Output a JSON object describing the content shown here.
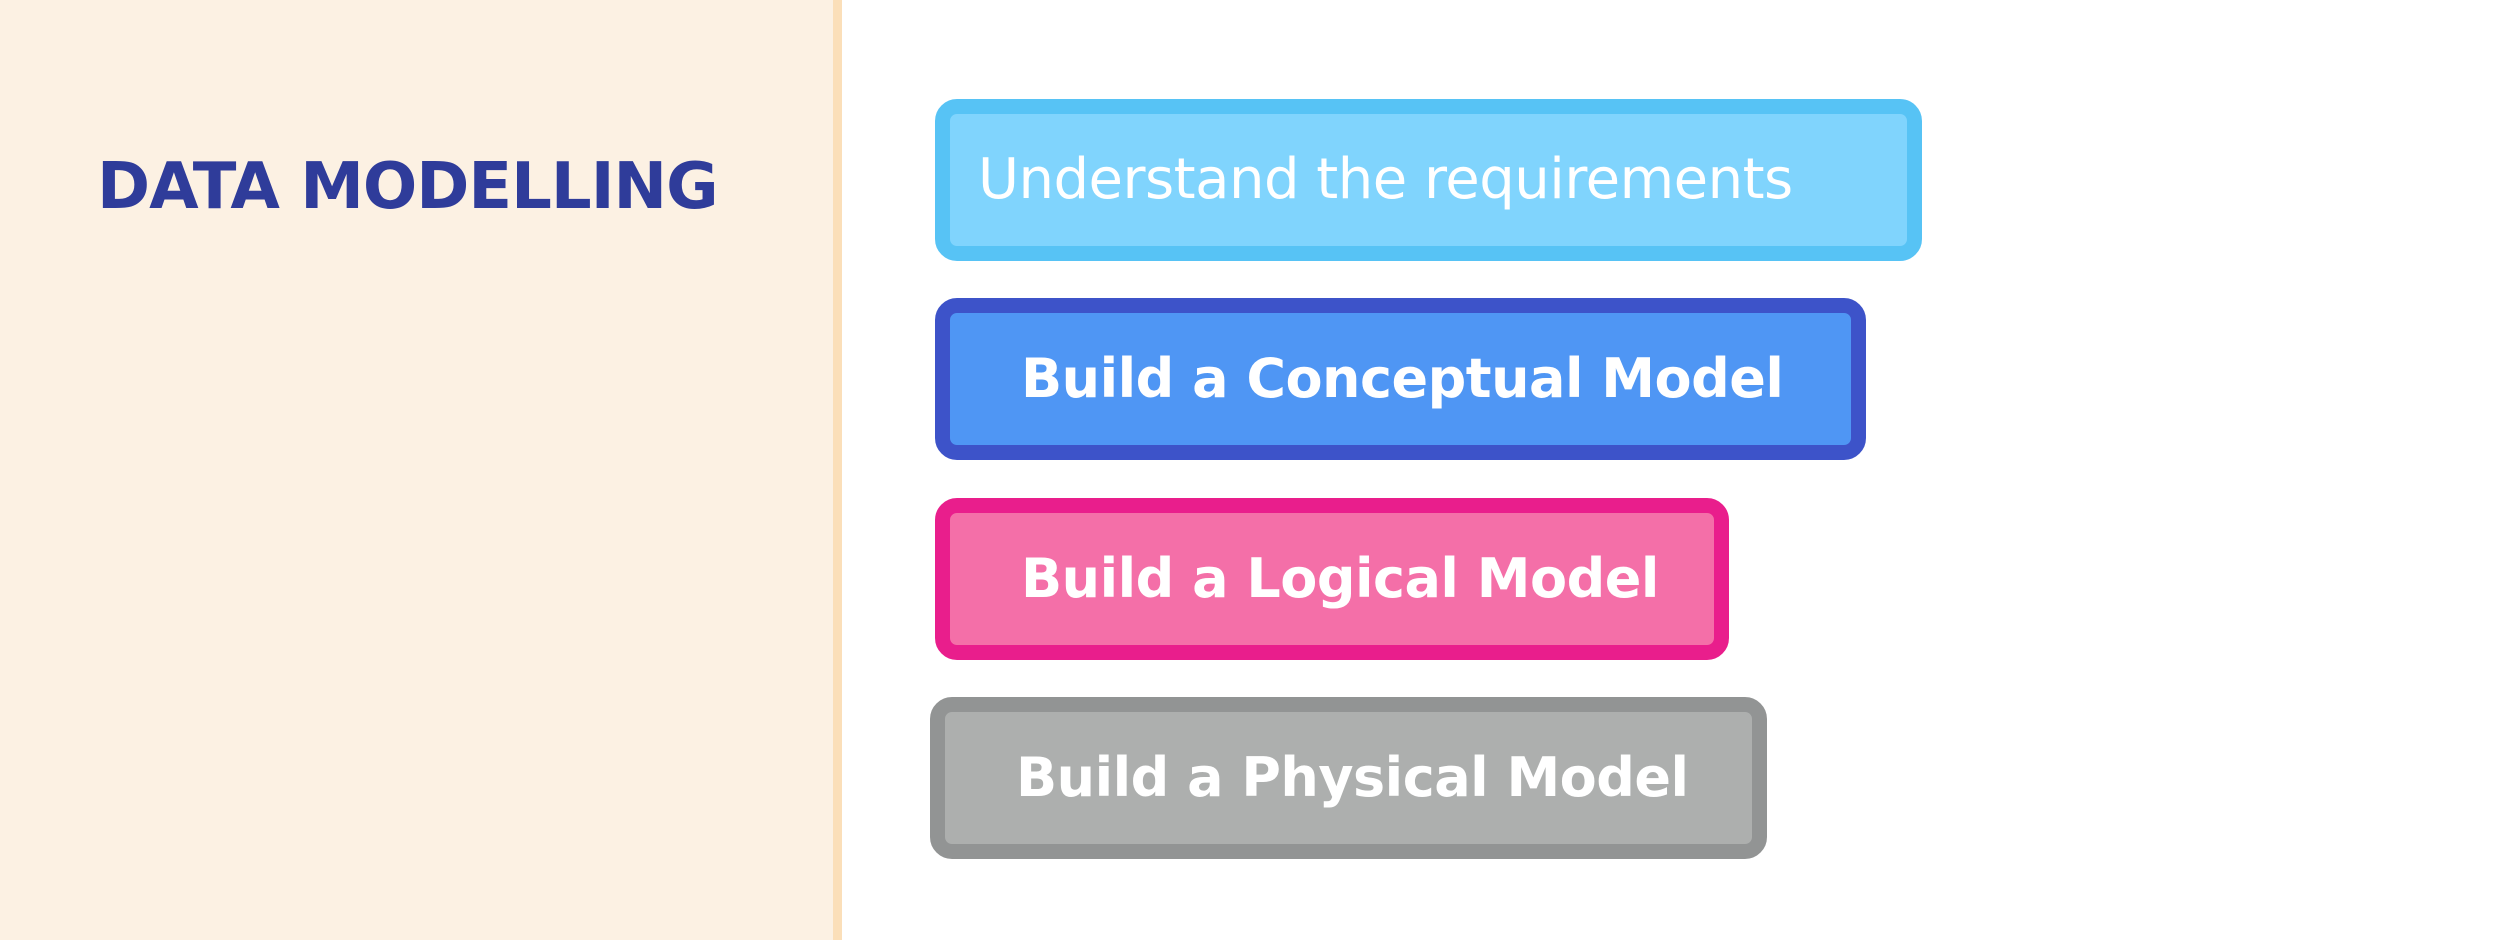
{
  "title": "DATA MODELLING",
  "steps": [
    {
      "label": "Understand the requirements",
      "fill": "#80d4fd",
      "border": "#57c3f5"
    },
    {
      "label": "Build a Conceptual Model",
      "fill": "#4f96f4",
      "border": "#3d53c9"
    },
    {
      "label": "Build a Logical Model",
      "fill": "#f46fa8",
      "border": "#e91e8c"
    },
    {
      "label": "Build a Physical Model",
      "fill": "#adafae",
      "border": "#929494"
    }
  ],
  "colors": {
    "title": "#2f3c9a",
    "left_panel": "#fcf1e3",
    "divider": "#fbdfb9",
    "background": "#ffffff"
  }
}
